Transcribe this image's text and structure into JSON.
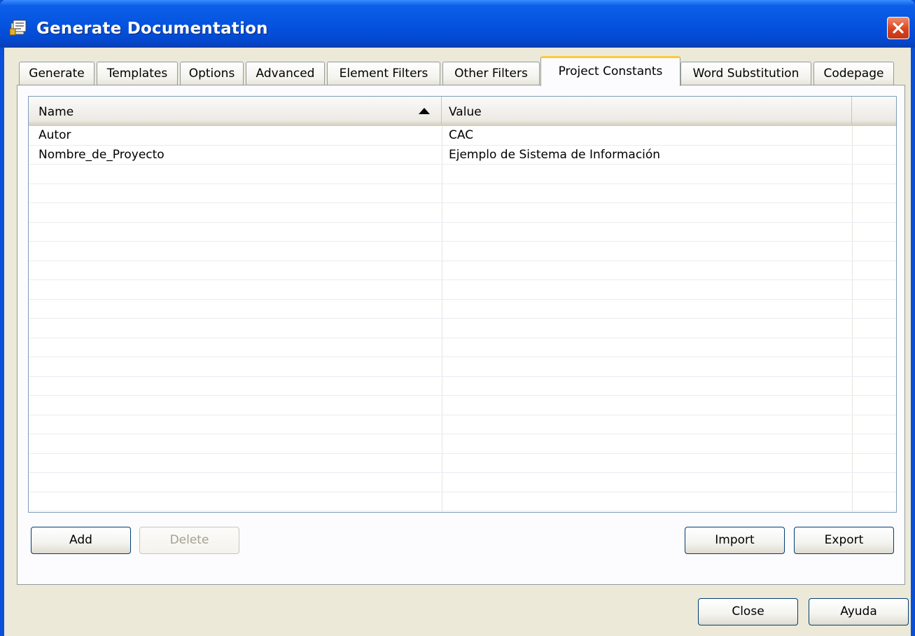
{
  "window": {
    "title": "Generate Documentation"
  },
  "icons": {
    "title": "documentation-icon",
    "close": "close-icon",
    "sort": "sort-ascending-icon"
  },
  "tabs": [
    {
      "label": "Generate"
    },
    {
      "label": "Templates"
    },
    {
      "label": "Options"
    },
    {
      "label": "Advanced"
    },
    {
      "label": "Element Filters"
    },
    {
      "label": "Other Filters"
    },
    {
      "label": "Project Constants",
      "active": true
    },
    {
      "label": "Word Substitution"
    },
    {
      "label": "Codepage"
    }
  ],
  "grid": {
    "columns": [
      "Name",
      "Value"
    ],
    "sort_column": "Name",
    "sort_direction": "ascending",
    "rows": [
      {
        "name": "Autor",
        "value": "CAC"
      },
      {
        "name": "Nombre_de_Proyecto",
        "value": "Ejemplo de Sistema de Información"
      }
    ]
  },
  "buttons": {
    "add": "Add",
    "delete": "Delete",
    "import": "Import",
    "export": "Export",
    "close": "Close",
    "help": "Ayuda"
  },
  "colors": {
    "titlebar": "#0454e0",
    "active_tab_accent": "#ffc83c",
    "dialog_bg": "#ece9d8",
    "close_button": "#d8451e"
  }
}
